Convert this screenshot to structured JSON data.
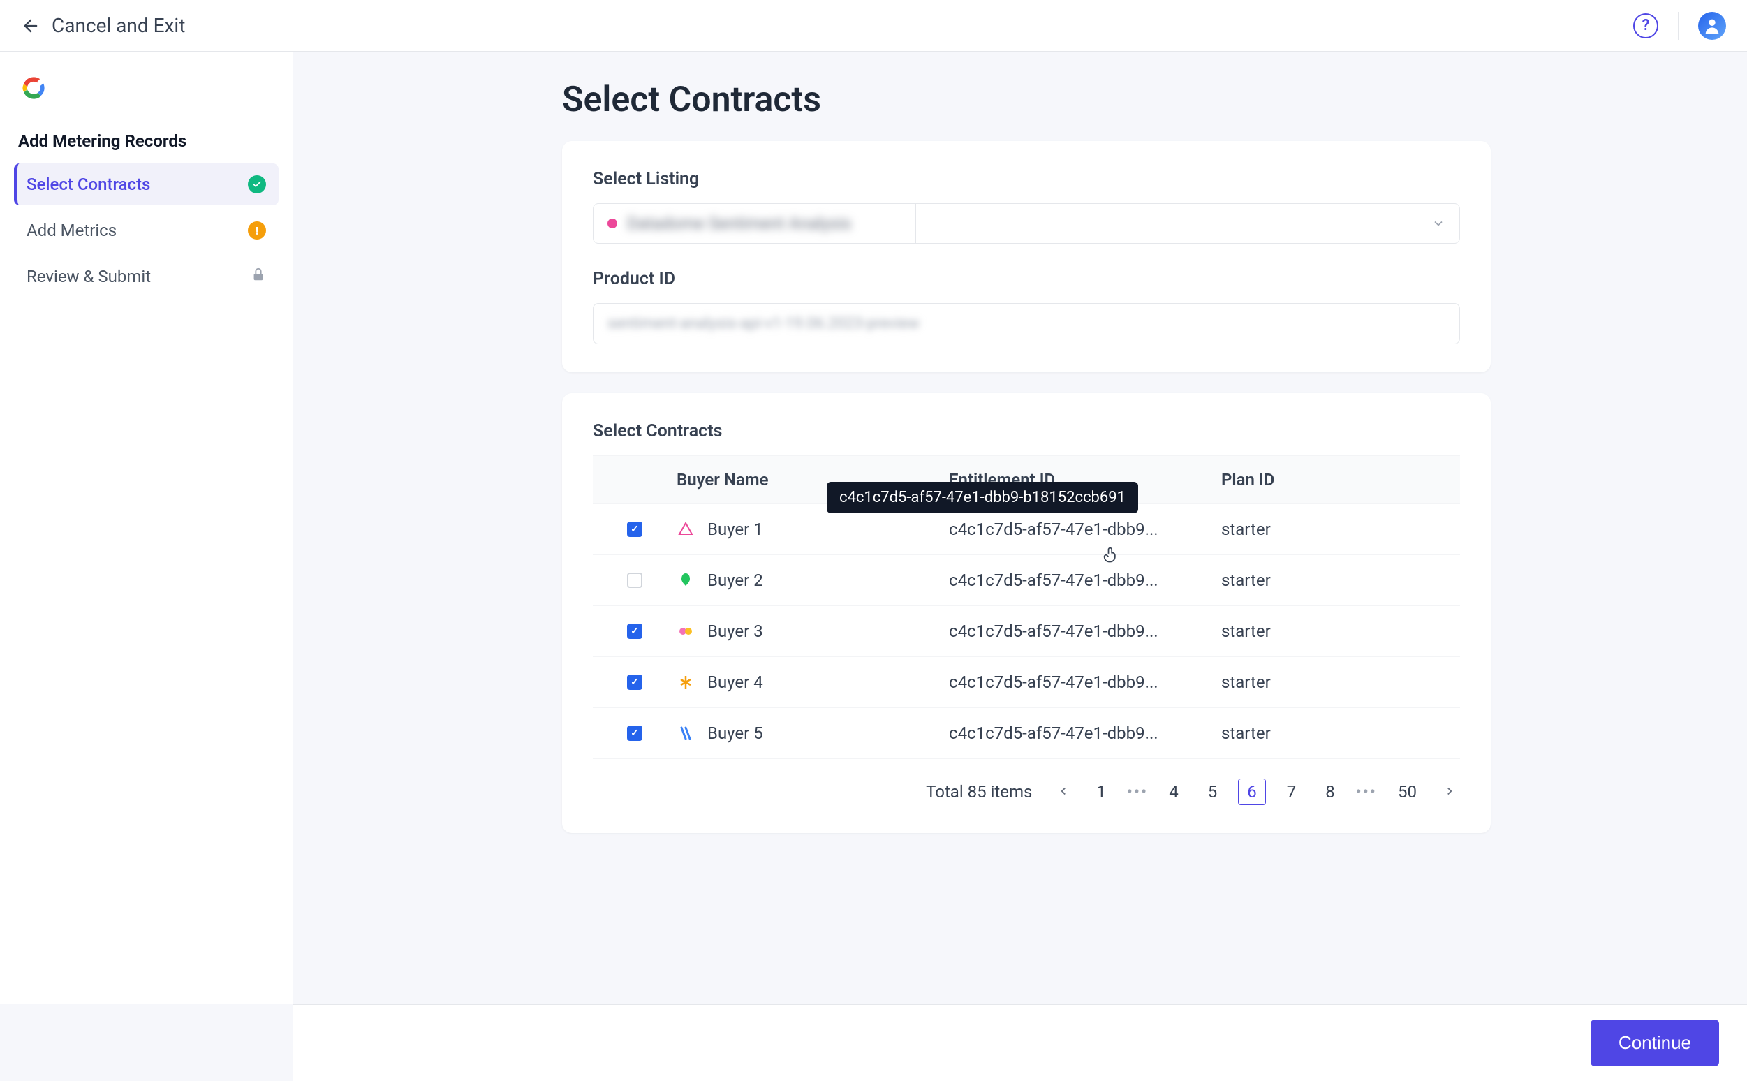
{
  "header": {
    "cancel_exit": "Cancel and Exit"
  },
  "sidebar": {
    "title": "Add Metering Records",
    "steps": [
      {
        "label": "Select Contracts",
        "status": "complete",
        "active": true
      },
      {
        "label": "Add Metrics",
        "status": "warn",
        "active": false
      },
      {
        "label": "Review & Submit",
        "status": "locked",
        "active": false
      }
    ]
  },
  "page": {
    "title": "Select Contracts"
  },
  "listing": {
    "section_label": "Select Listing",
    "display_text": "Datadome Sentiment Analysis",
    "product_label": "Product ID",
    "product_value": "sentiment-analysis-api-v1-19.06.2023-preview"
  },
  "contracts": {
    "section_label": "Select Contracts",
    "columns": {
      "buyer": "Buyer Name",
      "entitlement": "Entitlement ID",
      "plan": "Plan ID"
    },
    "tooltip_full": "c4c1c7d5-af57-47e1-dbb9-b18152ccb691",
    "rows": [
      {
        "checked": true,
        "name": "Buyer 1",
        "ent": "c4c1c7d5-af57-47e1-dbb9...",
        "plan": "starter",
        "color": "#ec4899",
        "show_tooltip": true
      },
      {
        "checked": false,
        "name": "Buyer 2",
        "ent": "c4c1c7d5-af57-47e1-dbb9...",
        "plan": "starter",
        "color": "#22c55e"
      },
      {
        "checked": true,
        "name": "Buyer 3",
        "ent": "c4c1c7d5-af57-47e1-dbb9...",
        "plan": "starter",
        "color": "#f472b6"
      },
      {
        "checked": true,
        "name": "Buyer 4",
        "ent": "c4c1c7d5-af57-47e1-dbb9...",
        "plan": "starter",
        "color": "#f59e0b"
      },
      {
        "checked": true,
        "name": "Buyer 5",
        "ent": "c4c1c7d5-af57-47e1-dbb9...",
        "plan": "starter",
        "color": "#3b82f6"
      }
    ]
  },
  "pagination": {
    "total_text": "Total 85 items",
    "pages": [
      "1",
      "...",
      "4",
      "5",
      "6",
      "7",
      "8",
      "...",
      "50"
    ],
    "current": "6"
  },
  "footer": {
    "continue": "Continue"
  }
}
